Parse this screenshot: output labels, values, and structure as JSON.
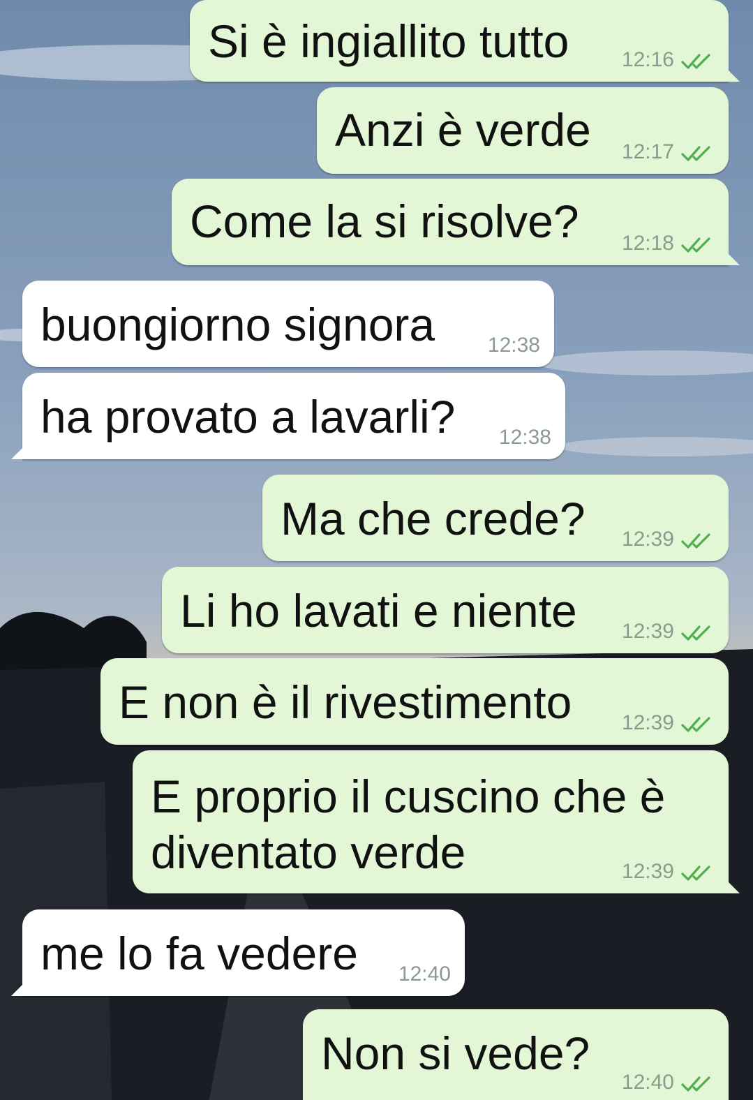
{
  "colors": {
    "outgoing_bubble": "#e3f7d6",
    "incoming_bubble": "#ffffff",
    "read_ticks": "#4fae4e",
    "timestamp": "#8a9a8c"
  },
  "messages": [
    {
      "direction": "out",
      "text": "Si è ingiallito tutto",
      "time": "12:16",
      "status": "read-double-check-icon"
    },
    {
      "direction": "out",
      "text": "Anzi è verde",
      "time": "12:17",
      "status": "read-double-check-icon"
    },
    {
      "direction": "out",
      "text": "Come la si risolve?",
      "time": "12:18",
      "status": "read-double-check-icon"
    },
    {
      "direction": "in",
      "text": "buongiorno signora",
      "time": "12:38"
    },
    {
      "direction": "in",
      "text": "ha provato a lavarli?",
      "time": "12:38"
    },
    {
      "direction": "out",
      "text": "Ma che crede?",
      "time": "12:39",
      "status": "read-double-check-icon"
    },
    {
      "direction": "out",
      "text": "Li ho lavati e niente",
      "time": "12:39",
      "status": "read-double-check-icon"
    },
    {
      "direction": "out",
      "text": "E non è il rivestimento",
      "time": "12:39",
      "status": "read-double-check-icon"
    },
    {
      "direction": "out",
      "text": "E proprio il cuscino che è\ndiventato verde",
      "time": "12:39",
      "status": "read-double-check-icon"
    },
    {
      "direction": "in",
      "text": "me lo fa vedere",
      "time": "12:40"
    },
    {
      "direction": "out",
      "text": "Non si vede?",
      "time": "12:40",
      "status": "read-double-check-icon"
    }
  ]
}
